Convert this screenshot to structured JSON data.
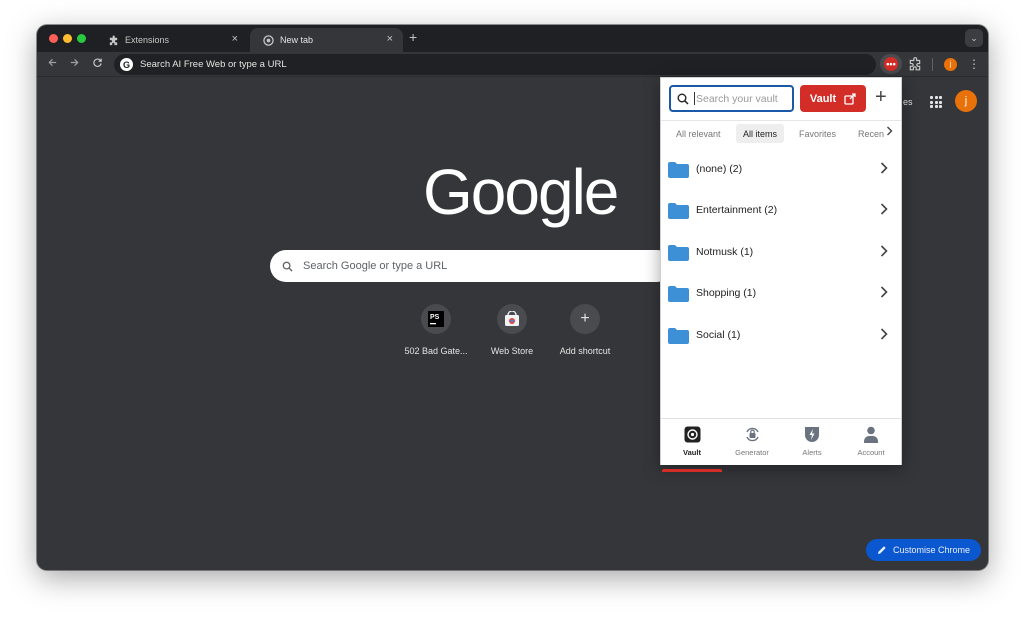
{
  "browser": {
    "tabs": [
      {
        "label": "Extensions",
        "icon": "puzzle-icon",
        "close": "×"
      },
      {
        "label": "New tab",
        "icon": "chrome-icon",
        "close": "×"
      }
    ],
    "new_tab_symbol": "+",
    "tab_menu_symbol": "⌄",
    "omnibox_text": "Search AI Free Web or type a URL",
    "toolbar_avatar_letter": "j"
  },
  "newtab_page": {
    "logo_text": "Google",
    "search_placeholder": "Search Google or type a URL",
    "partial_top_link": "es",
    "avatar_letter": "j",
    "shortcuts": [
      {
        "label": "502 Bad Gate...",
        "icon": "jetbrains-icon"
      },
      {
        "label": "Web Store",
        "icon": "web-store-icon"
      },
      {
        "label": "Add shortcut",
        "icon": "plus-icon",
        "symbol": "+"
      }
    ],
    "customise_label": "Customise Chrome"
  },
  "lastpass_popup": {
    "search_placeholder": "Search your vault",
    "vault_button_label": "Vault",
    "add_symbol": "+",
    "filter_tabs": [
      {
        "label": "All relevant",
        "selected": false
      },
      {
        "label": "All items",
        "selected": true
      },
      {
        "label": "Favorites",
        "selected": false
      },
      {
        "label": "Recen",
        "selected": false
      }
    ],
    "folders": [
      {
        "label": "(none) (2)"
      },
      {
        "label": "Entertainment (2)"
      },
      {
        "label": "Notmusk (1)"
      },
      {
        "label": "Shopping (1)"
      },
      {
        "label": "Social (1)"
      }
    ],
    "bottom_nav": [
      {
        "label": "Vault",
        "icon": "vault-icon",
        "active": true
      },
      {
        "label": "Generator",
        "icon": "generator-icon",
        "active": false
      },
      {
        "label": "Alerts",
        "icon": "alerts-icon",
        "active": false
      },
      {
        "label": "Account",
        "icon": "account-icon",
        "active": false
      }
    ],
    "colors": {
      "accent_red": "#d32d27",
      "folder_blue": "#3d8fd6",
      "search_border": "#1a58a8"
    }
  }
}
